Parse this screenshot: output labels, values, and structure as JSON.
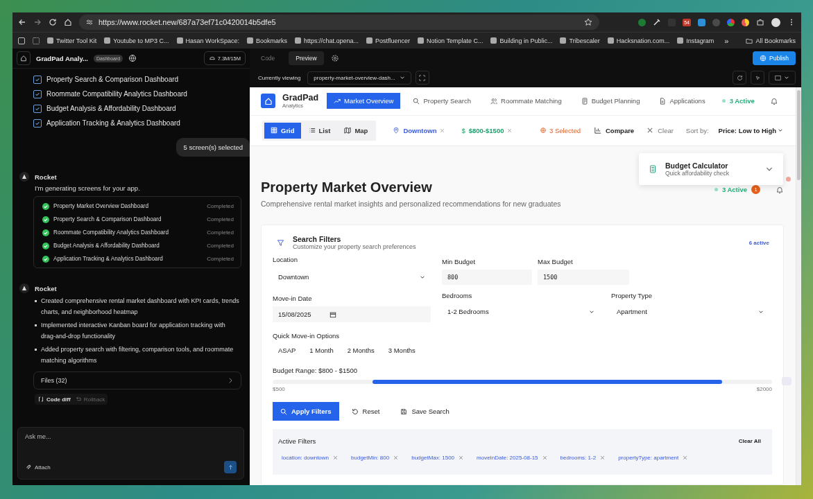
{
  "browser": {
    "url": "https://www.rocket.new/687a73ef71c0420014b5dfe5",
    "extension_badge": "54",
    "bookmarks": [
      "Twitter Tool Kit",
      "Youtube to MP3 C...",
      "Hasan WorkSpace:",
      "Bookmarks",
      "https://chat.opena...",
      "Postfluencer",
      "Notion Template C...",
      "Building in Public...",
      "Tribescaler",
      "Hacksnation.com...",
      "Instagram"
    ],
    "more": "»",
    "all_bookmarks": "All Bookmarks"
  },
  "sidebar": {
    "project": "GradPad Analy...",
    "badge": "Dashboard",
    "usage": "7.3M/15M",
    "screens": [
      {
        "label": "Property Search & Comparison Dashboard",
        "checked": true
      },
      {
        "label": "Roommate Compatibility Analytics Dashboard",
        "checked": true
      },
      {
        "label": "Budget Analysis & Affordability Dashboard",
        "checked": true
      },
      {
        "label": "Application Tracking & Analytics Dashboard",
        "checked": true
      }
    ],
    "selection": "5 screen(s) selected",
    "progress": {
      "author": "Rocket",
      "text": "I'm generating screens for your app.",
      "tasks": [
        {
          "name": "Property Market Overview Dashboard",
          "status": "Completed"
        },
        {
          "name": "Property Search & Comparison Dashboard",
          "status": "Completed"
        },
        {
          "name": "Roommate Compatibility Analytics Dashboard",
          "status": "Completed"
        },
        {
          "name": "Budget Analysis & Affordability Dashboard",
          "status": "Completed"
        },
        {
          "name": "Application Tracking & Analytics Dashboard",
          "status": "Completed"
        }
      ]
    },
    "summary": {
      "author": "Rocket",
      "bullets": [
        "Created comprehensive rental market dashboard with KPI cards, trends charts, and neighborhood heatmap",
        "Implemented interactive Kanban board for application tracking with drag-and-drop functionality",
        "Added property search with filtering, comparison tools, and roommate matching algorithms"
      ],
      "files": "Files (32)",
      "actions": [
        {
          "label": "Code diff",
          "disabled": false
        },
        {
          "label": "Rollback",
          "disabled": true
        }
      ]
    },
    "composer": {
      "placeholder": "Ask me...",
      "attach": "Attach"
    }
  },
  "editor": {
    "tabs": [
      {
        "label": "Code",
        "selected": false
      },
      {
        "label": "Preview",
        "selected": true
      }
    ],
    "publish": "Publish",
    "viewing_label": "Currently viewing",
    "viewing_value": "property-market-overview-dash..."
  },
  "app": {
    "brand": "GradPad",
    "brand_sub": "Analytics",
    "nav": [
      {
        "label": "Market Overview",
        "selected": true
      },
      {
        "label": "Property Search",
        "selected": false
      },
      {
        "label": "Roommate Matching",
        "selected": false
      },
      {
        "label": "Budget Planning",
        "selected": false
      },
      {
        "label": "Applications",
        "selected": false
      }
    ],
    "active": "3 Active",
    "views": [
      {
        "label": "Grid",
        "selected": true
      },
      {
        "label": "List",
        "selected": false
      },
      {
        "label": "Map",
        "selected": false
      }
    ],
    "chips": [
      {
        "label": "Downtown",
        "color": "#3b5bdb"
      },
      {
        "label": "$800-$1500",
        "symbol": "$",
        "color": "#1f9d6b"
      }
    ],
    "selected_count": "3 Selected",
    "compare": "Compare",
    "clear": "Clear",
    "sort_label": "Sort by:",
    "sort_value": "Price: Low to High",
    "calculator": {
      "title": "Budget Calculator",
      "subtitle": "Quick affordability check"
    },
    "page": {
      "title": "Property Market Overview",
      "subtitle": "Comprehensive rental market insights and personalized recommendations for new graduates",
      "active": "3 Active",
      "notifications": "1"
    },
    "filters": {
      "title": "Search Filters",
      "subtitle": "Customize your property search preferences",
      "count": "6 active",
      "location": {
        "label": "Location",
        "value": "Downtown"
      },
      "min_budget": {
        "label": "Min Budget",
        "value": "800"
      },
      "max_budget": {
        "label": "Max Budget",
        "value": "1500"
      },
      "move_in": {
        "label": "Move-in Date",
        "value": "15/08/2025"
      },
      "bedrooms": {
        "label": "Bedrooms",
        "value": "1-2 Bedrooms"
      },
      "property_type": {
        "label": "Property Type",
        "value": "Apartment"
      },
      "quick": {
        "label": "Quick Move-in Options",
        "options": [
          "ASAP",
          "1 Month",
          "2 Months",
          "3 Months"
        ]
      },
      "range": {
        "label": "Budget Range: $800 - $1500",
        "min": "$500",
        "max": "$2000",
        "level": 0.875
      },
      "apply": "Apply Filters",
      "reset": "Reset",
      "save": "Save Search",
      "active": {
        "title": "Active Filters",
        "clear": "Clear All",
        "chips": [
          "location: downtown",
          "budgetMin: 800",
          "budgetMax: 1500",
          "moveInDate: 2025-08-15",
          "bedrooms: 1-2",
          "propertyType: apartment"
        ]
      }
    }
  }
}
